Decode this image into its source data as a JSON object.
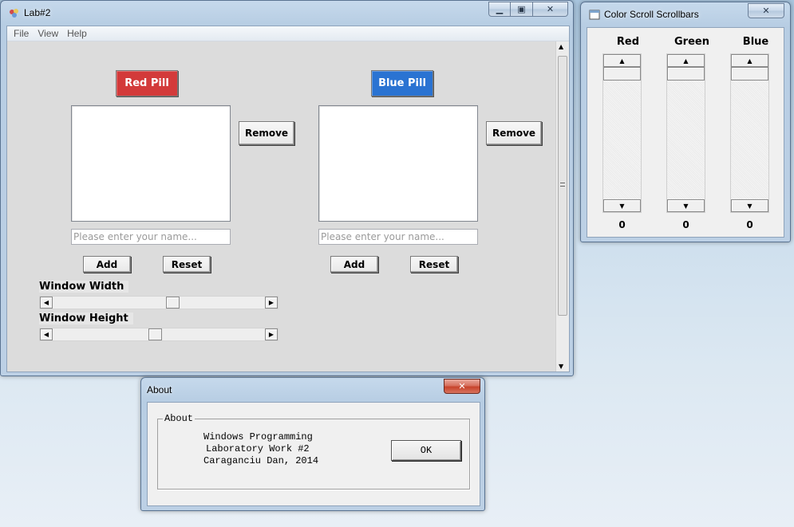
{
  "lab_window": {
    "title": "Lab#2",
    "menu": [
      "File",
      "View",
      "Help"
    ],
    "left_panel": {
      "pill_label": "Red Pill",
      "pill_color": "#d33a3a",
      "remove_label": "Remove",
      "name_placeholder": "Please enter your name...",
      "add_label": "Add",
      "reset_label": "Reset"
    },
    "right_panel": {
      "pill_label": "Blue Pill",
      "pill_color": "#2a73d2",
      "remove_label": "Remove",
      "name_placeholder": "Please enter your name...",
      "add_label": "Add",
      "reset_label": "Reset"
    },
    "width_label": "Window Width",
    "width_level": 0.57,
    "height_label": "Window Height",
    "height_level": 0.48
  },
  "color_window": {
    "title": "Color Scroll Scrollbars",
    "channels": [
      {
        "label": "Red",
        "value": "0"
      },
      {
        "label": "Green",
        "value": "0"
      },
      {
        "label": "Blue",
        "value": "0"
      }
    ]
  },
  "about_dialog": {
    "title": "About",
    "group_title": "About",
    "line1": "Windows Programming",
    "line2": "Laboratory Work #2",
    "line3": "Caraganciu Dan, 2014",
    "ok_label": "OK"
  },
  "icons": {
    "minimize": "minimize-icon",
    "maximize": "maximize-icon",
    "close": "close-icon"
  }
}
